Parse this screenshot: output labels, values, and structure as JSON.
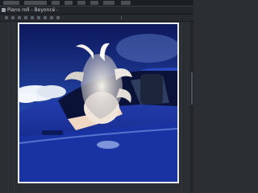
{
  "window": {
    "title": "Piano roll - Beyoncé -"
  },
  "icons": {
    "title_icon": "piano-roll-icon",
    "toolbar_icons": [
      "pointer-icon",
      "pencil-icon",
      "brush-icon",
      "delete-icon",
      "mute-icon",
      "slice-icon",
      "select-icon",
      "zoom-icon",
      "play-icon"
    ]
  },
  "image": {
    "description": "",
    "colors": {
      "sky_top": "#0e1a66",
      "sky_mid": "#2a4fb6",
      "cloud": "#dfe6f2",
      "car_body": "#1f3aa6",
      "car_dark": "#0c1540",
      "frame": "#e9ecef"
    }
  }
}
